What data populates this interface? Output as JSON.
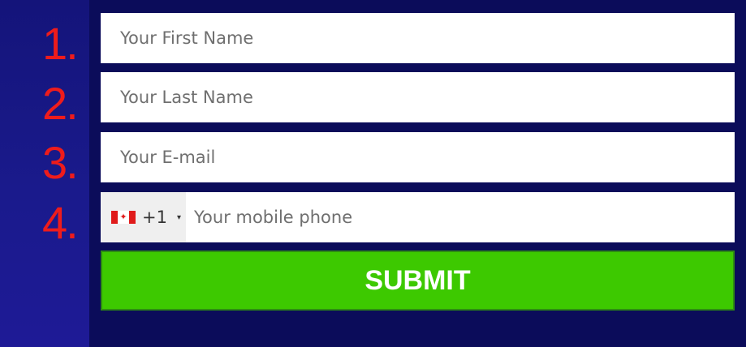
{
  "steps": [
    "1.",
    "2.",
    "3.",
    "4."
  ],
  "form": {
    "first_name_placeholder": "Your First Name",
    "last_name_placeholder": "Your Last Name",
    "email_placeholder": "Your E-mail",
    "phone": {
      "country_flag": "canada-flag-icon",
      "dial_code": "+1",
      "caret": "▾",
      "placeholder": "Your mobile phone"
    },
    "submit_label": "SUBMIT"
  },
  "colors": {
    "background": "#0b0c5a",
    "step_number": "#ee1c1c",
    "submit": "#3dc900"
  }
}
